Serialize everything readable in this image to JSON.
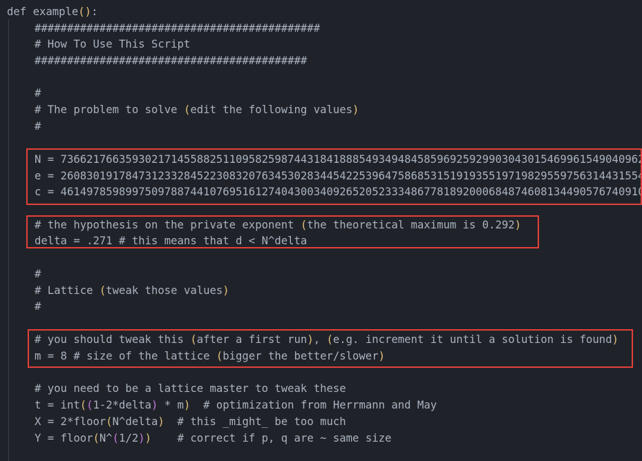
{
  "code": {
    "def_kw": "def",
    "fn_name": "example",
    "open_paren": "(",
    "close_paren": ")",
    "colon": ":",
    "hash_line_1": "############################################",
    "how_to": "# How To Use This Script",
    "hash_line_2": "##########################################",
    "blank_comment_1": "#",
    "problem_prefix": "# The problem to solve ",
    "problem_paren_open": "(",
    "problem_inner": "edit the following values",
    "problem_paren_close": ")",
    "blank_comment_2": "#",
    "n_line": "N = 736621766359302171455882511095825987443184188854934948458596925929903043015469961549040962",
    "e_line": "e = 260830191784731233284522308320763453028344542253964758685315191935519719829559756314431554",
    "c_line": "c = 461497859899750978874410769516127404300340926520523334867781892000684874608134490576740910",
    "hyp_prefix": "# the hypothesis on the private exponent ",
    "hyp_paren_open": "(",
    "hyp_inner": "the theoretical maximum is 0.292",
    "hyp_paren_close": ")",
    "delta_line": "delta = .271 # this means that d < N^delta",
    "blank_comment_3": "#",
    "lattice_prefix": "# Lattice ",
    "lattice_paren_open": "(",
    "lattice_inner": "tweak those values",
    "lattice_paren_close": ")",
    "blank_comment_4": "#",
    "tweak_prefix": "# you should tweak this ",
    "tweak_p1_open": "(",
    "tweak_p1_inner": "after a first run",
    "tweak_p1_close": ")",
    "tweak_mid": ", ",
    "tweak_p2_open": "(",
    "tweak_p2_inner": "e.g. increment it until a solution is found",
    "tweak_p2_close": ")",
    "m_prefix": "m = 8 # size of the lattice ",
    "m_paren_open": "(",
    "m_inner": "bigger the better/slower",
    "m_paren_close": ")",
    "master_line": "# you need to be a lattice master to tweak these",
    "t_prefix": "t = int",
    "t_open1": "(",
    "t_open2": "(",
    "t_inner": "1-2*delta",
    "t_close2": ")",
    "t_mid": " * m",
    "t_close1": ")",
    "t_comment": "  # optimization from Herrmann and May",
    "x_prefix": "X = 2*floor",
    "x_open": "(",
    "x_inner": "N^delta",
    "x_close": ")",
    "x_comment": "  # this _might_ be too much",
    "y_prefix": "Y = floor",
    "y_open1": "(",
    "y_inner1": "N^",
    "y_open2": "(",
    "y_inner2": "1/2",
    "y_close2": ")",
    "y_close1": ")",
    "y_comment": "    # correct if p, q are ~ same size"
  },
  "colors": {
    "background": "#1f2329",
    "text": "#abb2bf",
    "paren_level1": "#e5c07b",
    "paren_level2": "#c678dd",
    "highlight_border": "#e5403a"
  }
}
